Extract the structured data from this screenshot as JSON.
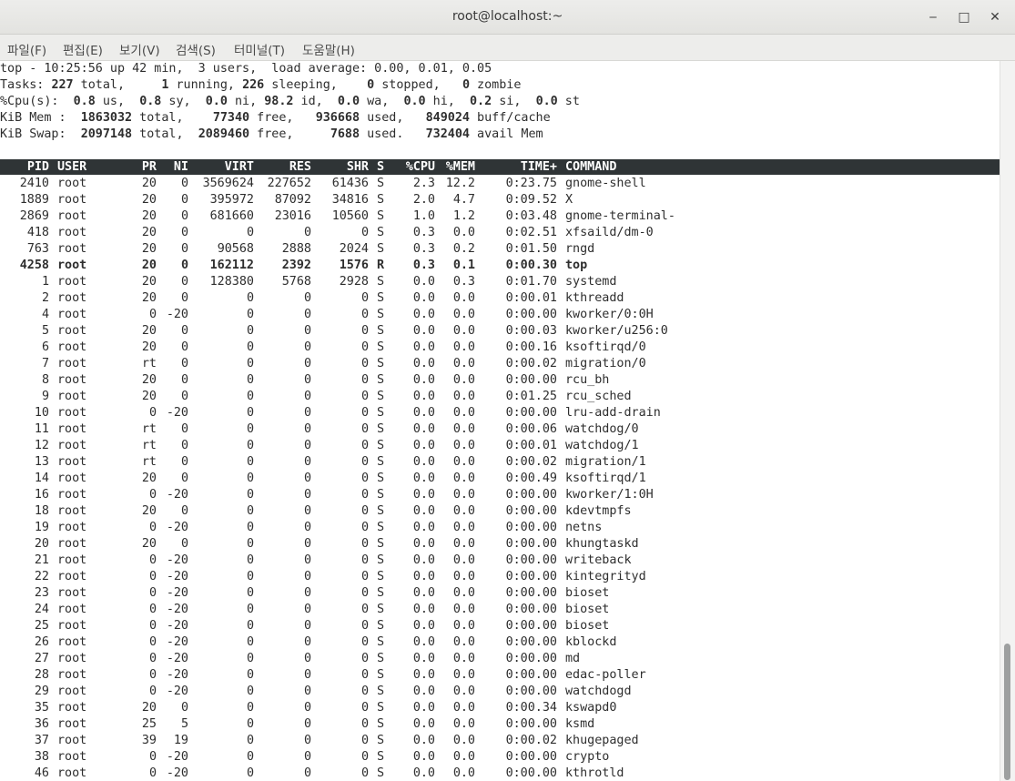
{
  "window": {
    "title": "root@localhost:~",
    "minimize_label": "‒",
    "maximize_label": "□",
    "close_label": "✕"
  },
  "menu": [
    {
      "label": "파일(F)"
    },
    {
      "label": "편집(E)"
    },
    {
      "label": "보기(V)"
    },
    {
      "label": "검색(S)"
    },
    {
      "label": "터미널(T)"
    },
    {
      "label": "도움말(H)"
    }
  ],
  "summary": {
    "line1": "top - 10:25:56 up 42 min,  3 users,  load average: 0.00, 0.01, 0.05",
    "tasks": {
      "label": "Tasks:",
      "total": "227",
      "running": "1",
      "sleeping": "226",
      "stopped": "0",
      "zombie": "0"
    },
    "cpu": {
      "label": "%Cpu(s):",
      "us": "0.8",
      "sy": "0.8",
      "ni": "0.0",
      "id": "98.2",
      "wa": "0.0",
      "hi": "0.0",
      "si": "0.2",
      "st": "0.0"
    },
    "mem": {
      "label": "KiB Mem :",
      "total": "1863032",
      "free": "77340",
      "used": "936668",
      "buff_cache": "849024"
    },
    "swap": {
      "label": "KiB Swap:",
      "total": "2097148",
      "free": "2089460",
      "used": "7688",
      "avail": "732404"
    }
  },
  "columns": [
    "PID",
    "USER",
    "PR",
    "NI",
    "VIRT",
    "RES",
    "SHR",
    "S",
    "%CPU",
    "%MEM",
    "TIME+",
    "COMMAND"
  ],
  "processes": [
    {
      "pid": "2410",
      "user": "root",
      "pr": "20",
      "ni": "0",
      "virt": "3569624",
      "res": "227652",
      "shr": "61436",
      "s": "S",
      "cpu": "2.3",
      "mem": "12.2",
      "time": "0:23.75",
      "command": "gnome-shell"
    },
    {
      "pid": "1889",
      "user": "root",
      "pr": "20",
      "ni": "0",
      "virt": "395972",
      "res": "87092",
      "shr": "34816",
      "s": "S",
      "cpu": "2.0",
      "mem": "4.7",
      "time": "0:09.52",
      "command": "X"
    },
    {
      "pid": "2869",
      "user": "root",
      "pr": "20",
      "ni": "0",
      "virt": "681660",
      "res": "23016",
      "shr": "10560",
      "s": "S",
      "cpu": "1.0",
      "mem": "1.2",
      "time": "0:03.48",
      "command": "gnome-terminal-"
    },
    {
      "pid": "418",
      "user": "root",
      "pr": "20",
      "ni": "0",
      "virt": "0",
      "res": "0",
      "shr": "0",
      "s": "S",
      "cpu": "0.3",
      "mem": "0.0",
      "time": "0:02.51",
      "command": "xfsaild/dm-0"
    },
    {
      "pid": "763",
      "user": "root",
      "pr": "20",
      "ni": "0",
      "virt": "90568",
      "res": "2888",
      "shr": "2024",
      "s": "S",
      "cpu": "0.3",
      "mem": "0.2",
      "time": "0:01.50",
      "command": "rngd"
    },
    {
      "pid": "4258",
      "user": "root",
      "pr": "20",
      "ni": "0",
      "virt": "162112",
      "res": "2392",
      "shr": "1576",
      "s": "R",
      "cpu": "0.3",
      "mem": "0.1",
      "time": "0:00.30",
      "command": "top",
      "bold": true
    },
    {
      "pid": "1",
      "user": "root",
      "pr": "20",
      "ni": "0",
      "virt": "128380",
      "res": "5768",
      "shr": "2928",
      "s": "S",
      "cpu": "0.0",
      "mem": "0.3",
      "time": "0:01.70",
      "command": "systemd"
    },
    {
      "pid": "2",
      "user": "root",
      "pr": "20",
      "ni": "0",
      "virt": "0",
      "res": "0",
      "shr": "0",
      "s": "S",
      "cpu": "0.0",
      "mem": "0.0",
      "time": "0:00.01",
      "command": "kthreadd"
    },
    {
      "pid": "4",
      "user": "root",
      "pr": "0",
      "ni": "-20",
      "virt": "0",
      "res": "0",
      "shr": "0",
      "s": "S",
      "cpu": "0.0",
      "mem": "0.0",
      "time": "0:00.00",
      "command": "kworker/0:0H"
    },
    {
      "pid": "5",
      "user": "root",
      "pr": "20",
      "ni": "0",
      "virt": "0",
      "res": "0",
      "shr": "0",
      "s": "S",
      "cpu": "0.0",
      "mem": "0.0",
      "time": "0:00.03",
      "command": "kworker/u256:0"
    },
    {
      "pid": "6",
      "user": "root",
      "pr": "20",
      "ni": "0",
      "virt": "0",
      "res": "0",
      "shr": "0",
      "s": "S",
      "cpu": "0.0",
      "mem": "0.0",
      "time": "0:00.16",
      "command": "ksoftirqd/0"
    },
    {
      "pid": "7",
      "user": "root",
      "pr": "rt",
      "ni": "0",
      "virt": "0",
      "res": "0",
      "shr": "0",
      "s": "S",
      "cpu": "0.0",
      "mem": "0.0",
      "time": "0:00.02",
      "command": "migration/0"
    },
    {
      "pid": "8",
      "user": "root",
      "pr": "20",
      "ni": "0",
      "virt": "0",
      "res": "0",
      "shr": "0",
      "s": "S",
      "cpu": "0.0",
      "mem": "0.0",
      "time": "0:00.00",
      "command": "rcu_bh"
    },
    {
      "pid": "9",
      "user": "root",
      "pr": "20",
      "ni": "0",
      "virt": "0",
      "res": "0",
      "shr": "0",
      "s": "S",
      "cpu": "0.0",
      "mem": "0.0",
      "time": "0:01.25",
      "command": "rcu_sched"
    },
    {
      "pid": "10",
      "user": "root",
      "pr": "0",
      "ni": "-20",
      "virt": "0",
      "res": "0",
      "shr": "0",
      "s": "S",
      "cpu": "0.0",
      "mem": "0.0",
      "time": "0:00.00",
      "command": "lru-add-drain"
    },
    {
      "pid": "11",
      "user": "root",
      "pr": "rt",
      "ni": "0",
      "virt": "0",
      "res": "0",
      "shr": "0",
      "s": "S",
      "cpu": "0.0",
      "mem": "0.0",
      "time": "0:00.06",
      "command": "watchdog/0"
    },
    {
      "pid": "12",
      "user": "root",
      "pr": "rt",
      "ni": "0",
      "virt": "0",
      "res": "0",
      "shr": "0",
      "s": "S",
      "cpu": "0.0",
      "mem": "0.0",
      "time": "0:00.01",
      "command": "watchdog/1"
    },
    {
      "pid": "13",
      "user": "root",
      "pr": "rt",
      "ni": "0",
      "virt": "0",
      "res": "0",
      "shr": "0",
      "s": "S",
      "cpu": "0.0",
      "mem": "0.0",
      "time": "0:00.02",
      "command": "migration/1"
    },
    {
      "pid": "14",
      "user": "root",
      "pr": "20",
      "ni": "0",
      "virt": "0",
      "res": "0",
      "shr": "0",
      "s": "S",
      "cpu": "0.0",
      "mem": "0.0",
      "time": "0:00.49",
      "command": "ksoftirqd/1"
    },
    {
      "pid": "16",
      "user": "root",
      "pr": "0",
      "ni": "-20",
      "virt": "0",
      "res": "0",
      "shr": "0",
      "s": "S",
      "cpu": "0.0",
      "mem": "0.0",
      "time": "0:00.00",
      "command": "kworker/1:0H"
    },
    {
      "pid": "18",
      "user": "root",
      "pr": "20",
      "ni": "0",
      "virt": "0",
      "res": "0",
      "shr": "0",
      "s": "S",
      "cpu": "0.0",
      "mem": "0.0",
      "time": "0:00.00",
      "command": "kdevtmpfs"
    },
    {
      "pid": "19",
      "user": "root",
      "pr": "0",
      "ni": "-20",
      "virt": "0",
      "res": "0",
      "shr": "0",
      "s": "S",
      "cpu": "0.0",
      "mem": "0.0",
      "time": "0:00.00",
      "command": "netns"
    },
    {
      "pid": "20",
      "user": "root",
      "pr": "20",
      "ni": "0",
      "virt": "0",
      "res": "0",
      "shr": "0",
      "s": "S",
      "cpu": "0.0",
      "mem": "0.0",
      "time": "0:00.00",
      "command": "khungtaskd"
    },
    {
      "pid": "21",
      "user": "root",
      "pr": "0",
      "ni": "-20",
      "virt": "0",
      "res": "0",
      "shr": "0",
      "s": "S",
      "cpu": "0.0",
      "mem": "0.0",
      "time": "0:00.00",
      "command": "writeback"
    },
    {
      "pid": "22",
      "user": "root",
      "pr": "0",
      "ni": "-20",
      "virt": "0",
      "res": "0",
      "shr": "0",
      "s": "S",
      "cpu": "0.0",
      "mem": "0.0",
      "time": "0:00.00",
      "command": "kintegrityd"
    },
    {
      "pid": "23",
      "user": "root",
      "pr": "0",
      "ni": "-20",
      "virt": "0",
      "res": "0",
      "shr": "0",
      "s": "S",
      "cpu": "0.0",
      "mem": "0.0",
      "time": "0:00.00",
      "command": "bioset"
    },
    {
      "pid": "24",
      "user": "root",
      "pr": "0",
      "ni": "-20",
      "virt": "0",
      "res": "0",
      "shr": "0",
      "s": "S",
      "cpu": "0.0",
      "mem": "0.0",
      "time": "0:00.00",
      "command": "bioset"
    },
    {
      "pid": "25",
      "user": "root",
      "pr": "0",
      "ni": "-20",
      "virt": "0",
      "res": "0",
      "shr": "0",
      "s": "S",
      "cpu": "0.0",
      "mem": "0.0",
      "time": "0:00.00",
      "command": "bioset"
    },
    {
      "pid": "26",
      "user": "root",
      "pr": "0",
      "ni": "-20",
      "virt": "0",
      "res": "0",
      "shr": "0",
      "s": "S",
      "cpu": "0.0",
      "mem": "0.0",
      "time": "0:00.00",
      "command": "kblockd"
    },
    {
      "pid": "27",
      "user": "root",
      "pr": "0",
      "ni": "-20",
      "virt": "0",
      "res": "0",
      "shr": "0",
      "s": "S",
      "cpu": "0.0",
      "mem": "0.0",
      "time": "0:00.00",
      "command": "md"
    },
    {
      "pid": "28",
      "user": "root",
      "pr": "0",
      "ni": "-20",
      "virt": "0",
      "res": "0",
      "shr": "0",
      "s": "S",
      "cpu": "0.0",
      "mem": "0.0",
      "time": "0:00.00",
      "command": "edac-poller"
    },
    {
      "pid": "29",
      "user": "root",
      "pr": "0",
      "ni": "-20",
      "virt": "0",
      "res": "0",
      "shr": "0",
      "s": "S",
      "cpu": "0.0",
      "mem": "0.0",
      "time": "0:00.00",
      "command": "watchdogd"
    },
    {
      "pid": "35",
      "user": "root",
      "pr": "20",
      "ni": "0",
      "virt": "0",
      "res": "0",
      "shr": "0",
      "s": "S",
      "cpu": "0.0",
      "mem": "0.0",
      "time": "0:00.34",
      "command": "kswapd0"
    },
    {
      "pid": "36",
      "user": "root",
      "pr": "25",
      "ni": "5",
      "virt": "0",
      "res": "0",
      "shr": "0",
      "s": "S",
      "cpu": "0.0",
      "mem": "0.0",
      "time": "0:00.00",
      "command": "ksmd"
    },
    {
      "pid": "37",
      "user": "root",
      "pr": "39",
      "ni": "19",
      "virt": "0",
      "res": "0",
      "shr": "0",
      "s": "S",
      "cpu": "0.0",
      "mem": "0.0",
      "time": "0:00.02",
      "command": "khugepaged"
    },
    {
      "pid": "38",
      "user": "root",
      "pr": "0",
      "ni": "-20",
      "virt": "0",
      "res": "0",
      "shr": "0",
      "s": "S",
      "cpu": "0.0",
      "mem": "0.0",
      "time": "0:00.00",
      "command": "crypto"
    },
    {
      "pid": "46",
      "user": "root",
      "pr": "0",
      "ni": "-20",
      "virt": "0",
      "res": "0",
      "shr": "0",
      "s": "S",
      "cpu": "0.0",
      "mem": "0.0",
      "time": "0:00.00",
      "command": "kthrotld"
    }
  ]
}
